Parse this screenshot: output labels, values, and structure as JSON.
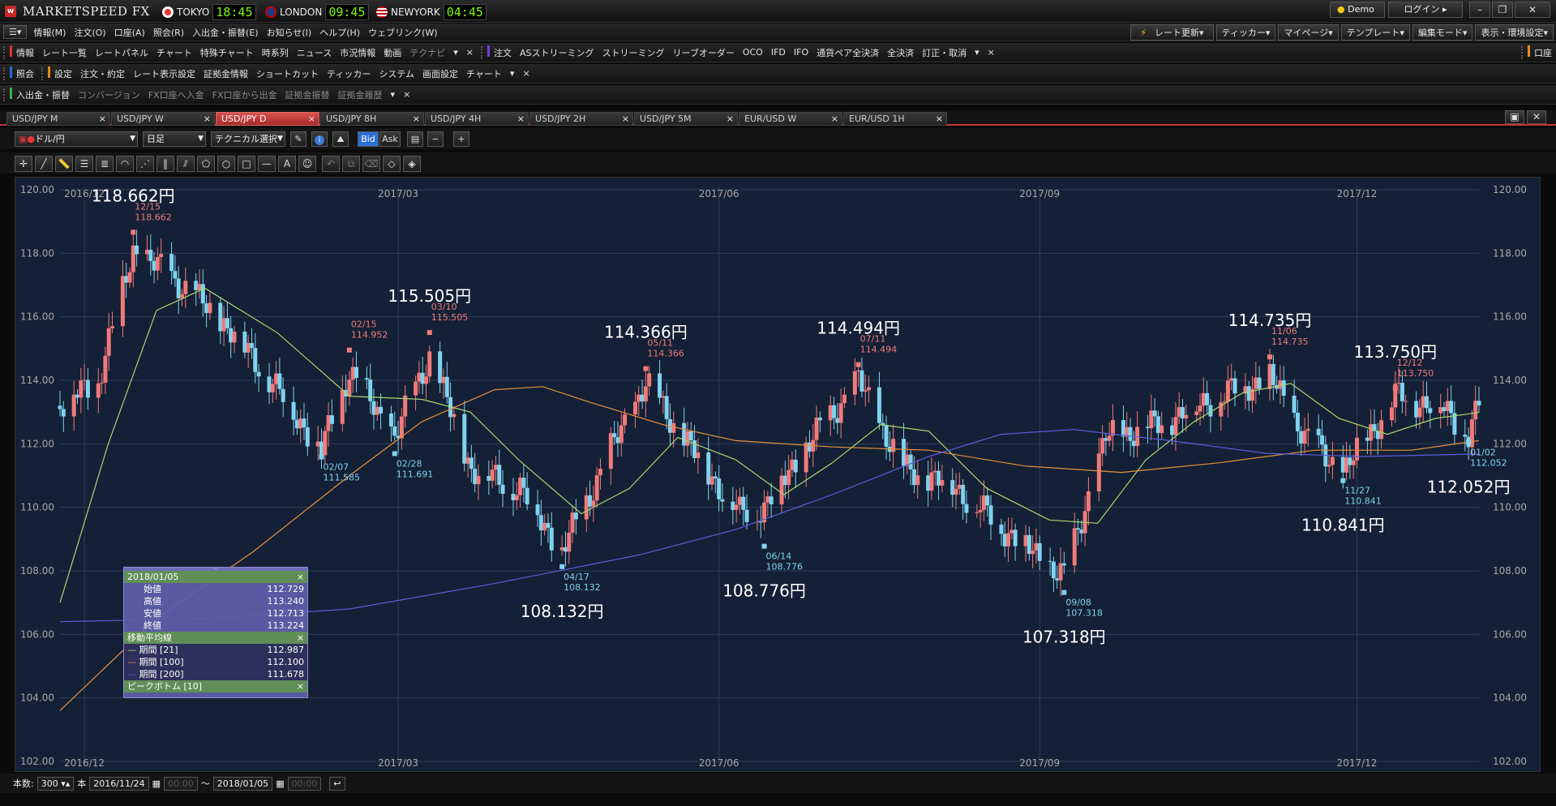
{
  "app": {
    "title": "MARKETSPEED FX"
  },
  "clocks": [
    {
      "city": "TOKYO",
      "time": "18:45",
      "color": "#e53935"
    },
    {
      "city": "LONDON",
      "time": "09:45",
      "color": "#1e3a8a"
    },
    {
      "city": "NEWYORK",
      "time": "04:45",
      "color": "#8fa7d6"
    }
  ],
  "title_buttons": {
    "demo": "Demo",
    "login": "ログイン"
  },
  "menu_row": {
    "items": [
      "情報(M)",
      "注文(O)",
      "口座(A)",
      "照会(R)",
      "入出金・振替(E)",
      "お知らせ(I)",
      "ヘルプ(H)",
      "ウェブリンク(W)"
    ],
    "right_items": [
      "レート更新▾",
      "ティッカー▾",
      "マイページ▾",
      "テンプレート▾",
      "編集モード▾",
      "表示・環境設定▾"
    ]
  },
  "info_row": {
    "label": "情報",
    "items": [
      "レート一覧",
      "レートパネル",
      "チャート",
      "特殊チャート",
      "時系列",
      "ニュース",
      "市況情報",
      "動画"
    ],
    "dim": "テクナビ",
    "order_label": "注文",
    "order_items": [
      "ASストリーミング",
      "ストリーミング",
      "リーブオーダー",
      "OCO",
      "IFD",
      "IFO",
      "通貨ペア全決済",
      "全決済",
      "訂正・取消"
    ],
    "account_label": "口座"
  },
  "ref_row": {
    "label": "照会",
    "settings_label": "設定",
    "items": [
      "注文・約定",
      "レート表示設定",
      "証拠金情報",
      "ショートカット",
      "ティッカー",
      "システム",
      "画面設定",
      "チャート"
    ]
  },
  "fund_row": {
    "label": "入出金・振替",
    "items": [
      "コンバージョン",
      "FX口座へ入金",
      "FX口座から出金",
      "証拠金振替",
      "証拠金履歴"
    ]
  },
  "tabs": [
    "USD/JPY M",
    "USD/JPY W",
    "USD/JPY D",
    "USD/JPY 8H",
    "USD/JPY 4H",
    "USD/JPY 2H",
    "USD/JPY 5M",
    "EUR/USD W",
    "EUR/USD 1H"
  ],
  "active_tab": 2,
  "toolbar": {
    "pair": "ドル/円",
    "period": "日足",
    "technical": "テクニカル選択",
    "bid": "Bid",
    "ask": "Ask"
  },
  "chart_data": {
    "type": "candlestick",
    "symbol": "USD/JPY",
    "timeframe": "daily",
    "x_range": [
      "2016/11/24",
      "2018/01/05"
    ],
    "x_ticks": [
      "2016/12",
      "2017/03",
      "2017/06",
      "2017/09",
      "2017/12"
    ],
    "ylim": [
      102,
      120
    ],
    "y_ticks": [
      "120.00",
      "118.00",
      "116.00",
      "114.00",
      "112.00",
      "110.00",
      "108.00",
      "106.00",
      "104.00",
      "102.00"
    ],
    "close_series": [
      {
        "date": "2016-11-24",
        "close": 113.2
      },
      {
        "date": "2016-12-05",
        "close": 114.0
      },
      {
        "date": "2016-12-15",
        "close": 118.1
      },
      {
        "date": "2016-12-28",
        "close": 117.1
      },
      {
        "date": "2017-01-10",
        "close": 115.8
      },
      {
        "date": "2017-01-20",
        "close": 114.5
      },
      {
        "date": "2017-02-07",
        "close": 111.8
      },
      {
        "date": "2017-02-15",
        "close": 114.3
      },
      {
        "date": "2017-02-28",
        "close": 112.2
      },
      {
        "date": "2017-03-10",
        "close": 114.8
      },
      {
        "date": "2017-03-22",
        "close": 111.2
      },
      {
        "date": "2017-04-05",
        "close": 110.6
      },
      {
        "date": "2017-04-17",
        "close": 108.6
      },
      {
        "date": "2017-05-01",
        "close": 111.8
      },
      {
        "date": "2017-05-11",
        "close": 113.9
      },
      {
        "date": "2017-05-25",
        "close": 111.7
      },
      {
        "date": "2017-06-07",
        "close": 109.8
      },
      {
        "date": "2017-06-14",
        "close": 110.0
      },
      {
        "date": "2017-06-26",
        "close": 111.9
      },
      {
        "date": "2017-07-11",
        "close": 114.0
      },
      {
        "date": "2017-07-24",
        "close": 111.2
      },
      {
        "date": "2017-08-07",
        "close": 110.7
      },
      {
        "date": "2017-08-22",
        "close": 109.3
      },
      {
        "date": "2017-09-08",
        "close": 107.8
      },
      {
        "date": "2017-09-20",
        "close": 112.2
      },
      {
        "date": "2017-10-05",
        "close": 112.6
      },
      {
        "date": "2017-10-20",
        "close": 113.4
      },
      {
        "date": "2017-11-06",
        "close": 114.1
      },
      {
        "date": "2017-11-17",
        "close": 112.1
      },
      {
        "date": "2017-11-27",
        "close": 111.1
      },
      {
        "date": "2017-12-12",
        "close": 113.5
      },
      {
        "date": "2017-12-25",
        "close": 113.2
      },
      {
        "date": "2018-01-02",
        "close": 112.3
      },
      {
        "date": "2018-01-05",
        "close": 113.224
      }
    ],
    "peaks": [
      {
        "date": "12/15",
        "value": "118.662",
        "big": "118.662円",
        "x": "2016-12-15",
        "y": 118.662
      },
      {
        "date": "02/15",
        "value": "114.952",
        "x": "2017-02-15",
        "y": 114.952
      },
      {
        "date": "03/10",
        "value": "115.505",
        "big": "115.505円",
        "x": "2017-03-10",
        "y": 115.505
      },
      {
        "date": "05/11",
        "value": "114.366",
        "big": "114.366円",
        "x": "2017-05-11",
        "y": 114.366
      },
      {
        "date": "07/11",
        "value": "114.494",
        "big": "114.494円",
        "x": "2017-07-11",
        "y": 114.494
      },
      {
        "date": "11/06",
        "value": "114.735",
        "big": "114.735円",
        "x": "2017-11-06",
        "y": 114.735
      },
      {
        "date": "12/12",
        "value": "113.750",
        "big": "113.750円",
        "x": "2017-12-12",
        "y": 113.75
      }
    ],
    "bottoms": [
      {
        "date": "02/07",
        "value": "111.585",
        "x": "2017-02-07",
        "y": 111.585
      },
      {
        "date": "02/28",
        "value": "111.691",
        "x": "2017-02-28",
        "y": 111.691
      },
      {
        "date": "04/17",
        "value": "108.132",
        "big": "108.132円",
        "x": "2017-04-17",
        "y": 108.132
      },
      {
        "date": "06/14",
        "value": "108.776",
        "big": "108.776円",
        "x": "2017-06-14",
        "y": 108.776
      },
      {
        "date": "09/08",
        "value": "107.318",
        "big": "107.318円",
        "x": "2017-09-08",
        "y": 107.318
      },
      {
        "date": "11/27",
        "value": "110.841",
        "big": "110.841円",
        "x": "2017-11-27",
        "y": 110.841
      },
      {
        "date": "01/02",
        "value": "112.052",
        "big": "112.052円",
        "x": "2018-01-02",
        "y": 112.052
      }
    ],
    "moving_averages": [
      {
        "name": "期間 [21]",
        "color": "#a8d86e",
        "values": [
          [
            0,
            107.0
          ],
          [
            10,
            112
          ],
          [
            20,
            116.2
          ],
          [
            30,
            116.9
          ],
          [
            45,
            115.5
          ],
          [
            60,
            113.5
          ],
          [
            75,
            113.4
          ],
          [
            85,
            113.0
          ],
          [
            95,
            111.5
          ],
          [
            108,
            109.8
          ],
          [
            118,
            110.6
          ],
          [
            128,
            112.2
          ],
          [
            140,
            111.5
          ],
          [
            150,
            110.4
          ],
          [
            160,
            111.4
          ],
          [
            170,
            112.6
          ],
          [
            180,
            112.4
          ],
          [
            192,
            110.6
          ],
          [
            205,
            109.6
          ],
          [
            215,
            109.5
          ],
          [
            225,
            111.5
          ],
          [
            235,
            112.7
          ],
          [
            245,
            113.6
          ],
          [
            255,
            113.9
          ],
          [
            265,
            112.8
          ],
          [
            275,
            112.3
          ],
          [
            285,
            112.8
          ],
          [
            294,
            112.987
          ]
        ]
      },
      {
        "name": "期間 [100]",
        "color": "#e8913a",
        "values": [
          [
            0,
            103.6
          ],
          [
            20,
            106.5
          ],
          [
            40,
            108.6
          ],
          [
            60,
            111.0
          ],
          [
            75,
            112.7
          ],
          [
            90,
            113.7
          ],
          [
            100,
            113.8
          ],
          [
            110,
            113.3
          ],
          [
            125,
            112.6
          ],
          [
            140,
            112.1
          ],
          [
            160,
            111.9
          ],
          [
            180,
            111.8
          ],
          [
            200,
            111.3
          ],
          [
            220,
            111.1
          ],
          [
            240,
            111.4
          ],
          [
            260,
            111.8
          ],
          [
            280,
            111.8
          ],
          [
            294,
            112.1
          ]
        ]
      },
      {
        "name": "期間 [200]",
        "color": "#5a5ee0",
        "values": [
          [
            0,
            106.4
          ],
          [
            30,
            106.5
          ],
          [
            60,
            106.8
          ],
          [
            90,
            107.6
          ],
          [
            120,
            108.5
          ],
          [
            140,
            109.3
          ],
          [
            160,
            110.4
          ],
          [
            180,
            111.6
          ],
          [
            195,
            112.3
          ],
          [
            210,
            112.45
          ],
          [
            230,
            112.1
          ],
          [
            250,
            111.7
          ],
          [
            270,
            111.6
          ],
          [
            294,
            111.678
          ]
        ]
      }
    ]
  },
  "info_panel": {
    "date": "2018/01/05",
    "ohlc": [
      {
        "label": "始値",
        "value": "112.729"
      },
      {
        "label": "高値",
        "value": "113.240"
      },
      {
        "label": "安値",
        "value": "112.713"
      },
      {
        "label": "終値",
        "value": "113.224"
      }
    ],
    "ma_title": "移動平均線",
    "ma": [
      {
        "label": "期間 [21]",
        "value": "112.987"
      },
      {
        "label": "期間 [100]",
        "value": "112.100"
      },
      {
        "label": "期間 [200]",
        "value": "111.678"
      }
    ],
    "peak_title": "ピークボトム [10]"
  },
  "status": {
    "count_label": "本数:",
    "count": "300",
    "unit": "本",
    "start": "2016/11/24",
    "start_time": "00:00",
    "tilde": "〜",
    "end": "2018/01/05",
    "end_time": "00:00"
  },
  "close": "×"
}
